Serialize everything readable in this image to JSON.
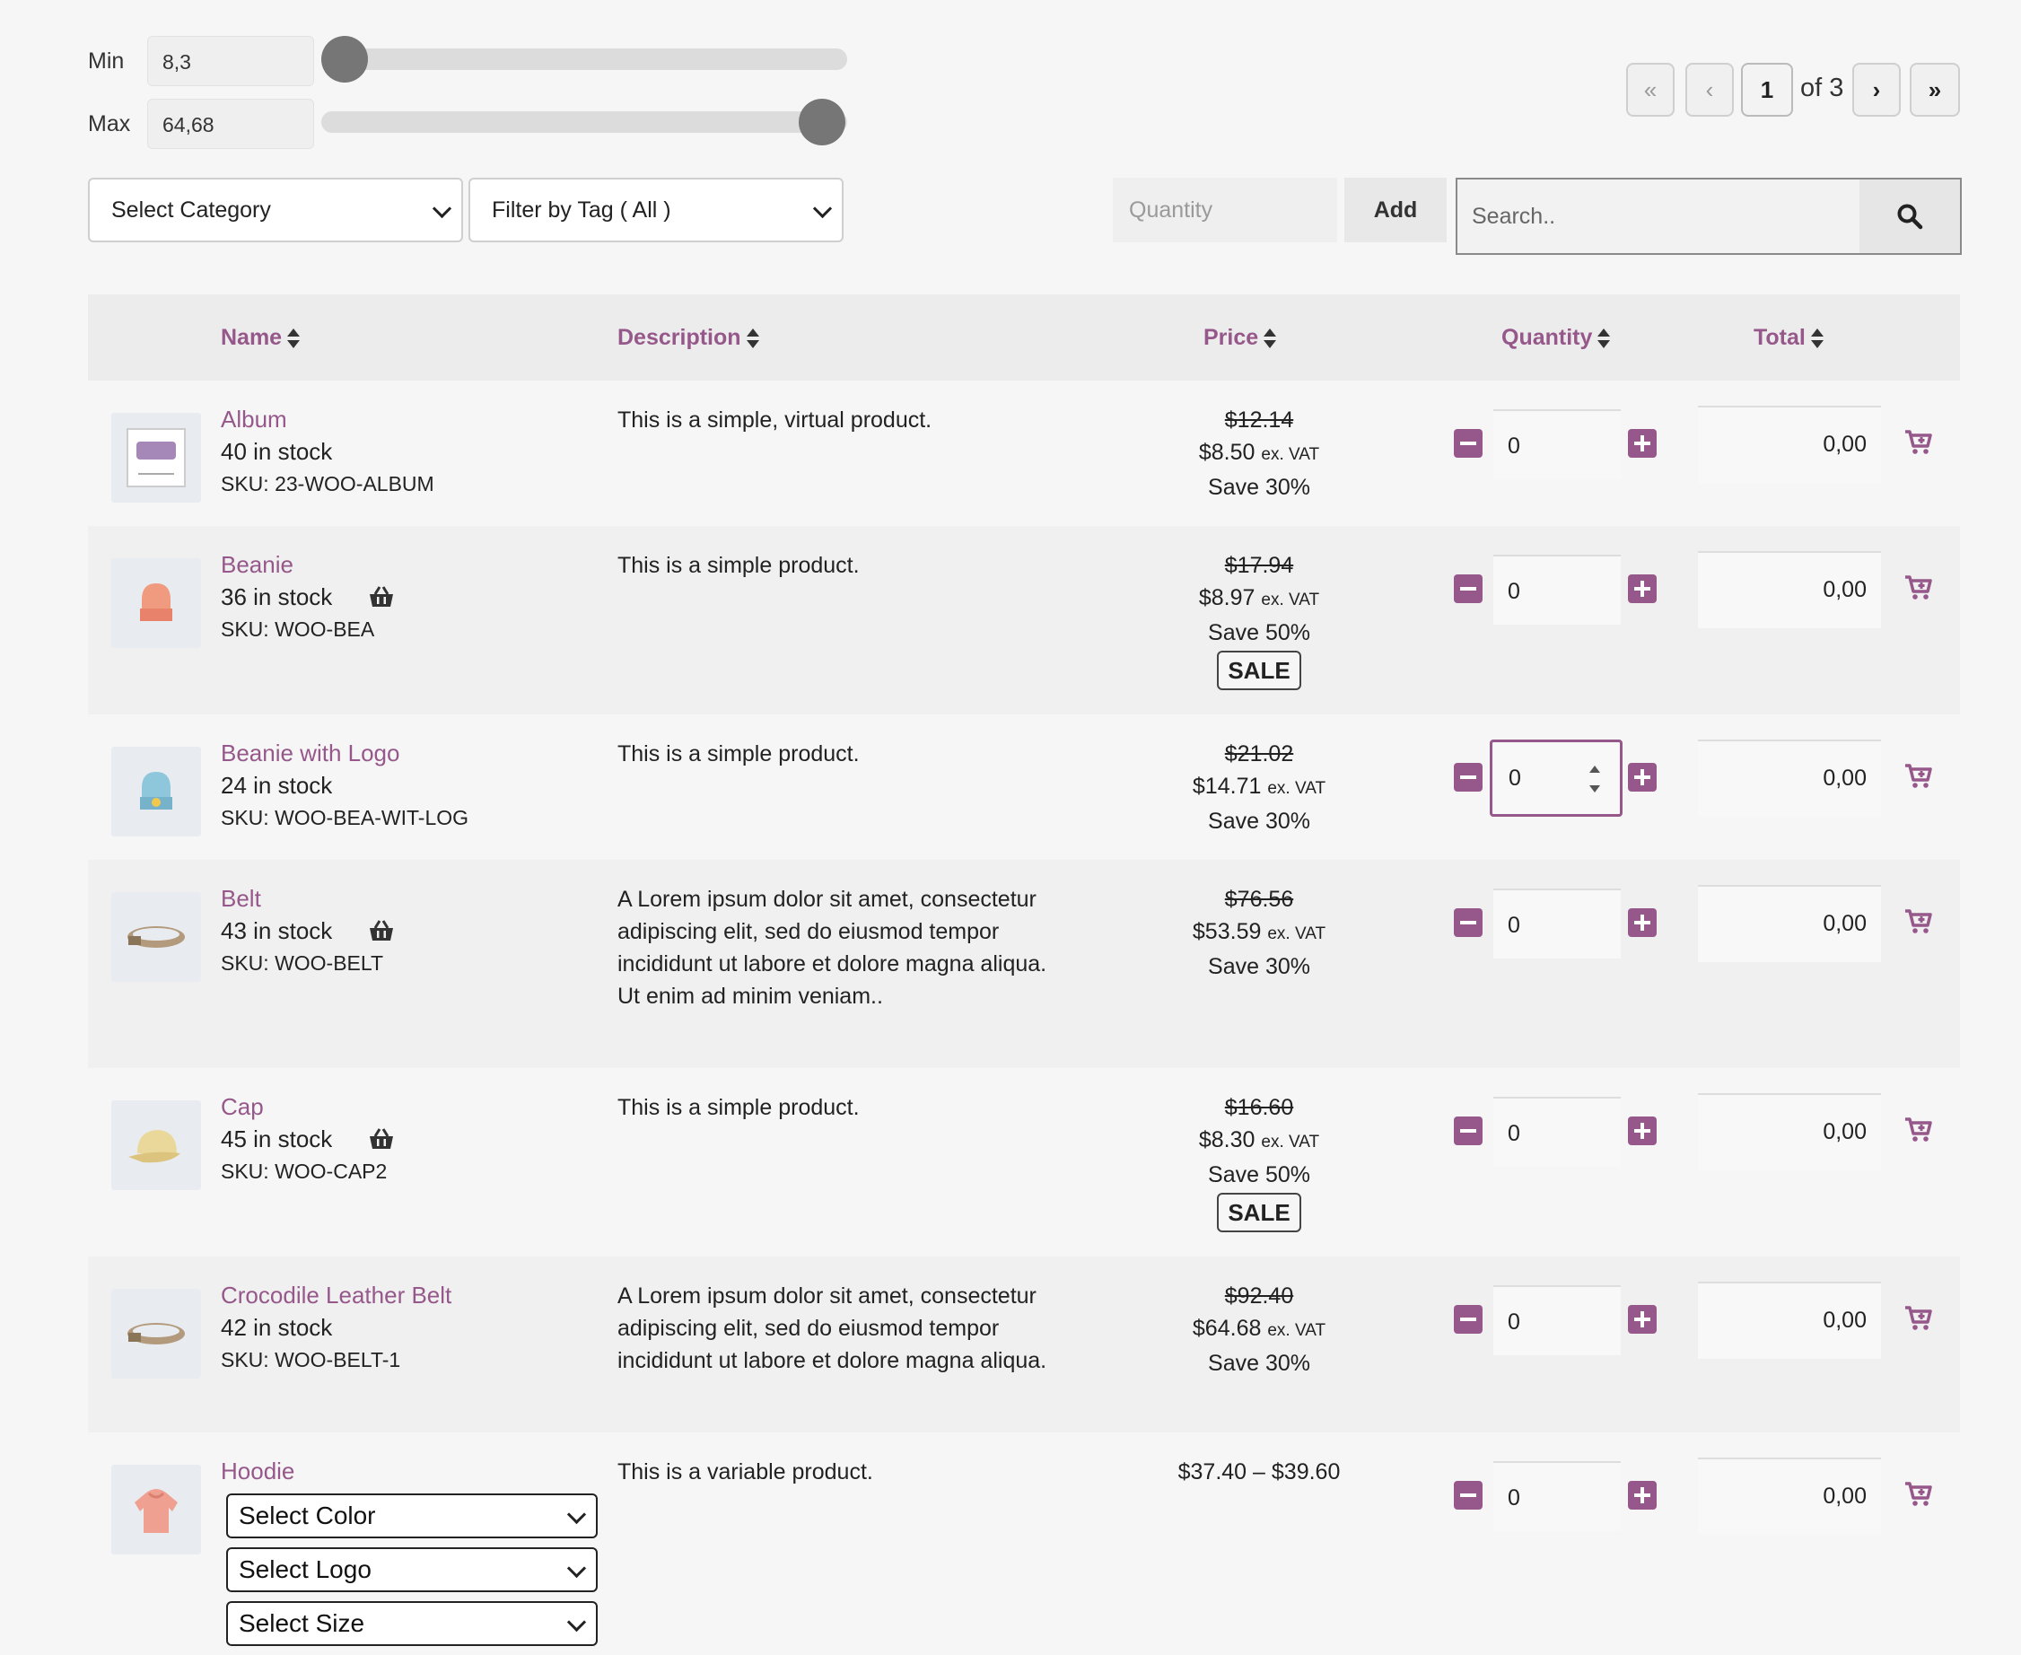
{
  "price_filter": {
    "min_label": "Min",
    "min_value": "8,3",
    "max_label": "Max",
    "max_value": "64,68"
  },
  "pagination": {
    "first": "«",
    "prev": "‹",
    "current": "1",
    "of_total": "of 3",
    "next": "›",
    "last": "»"
  },
  "filters": {
    "category": "Select Category",
    "tag": "Filter by Tag ( All )",
    "quantity_placeholder": "Quantity",
    "add_label": "Add",
    "search_placeholder": "Search.."
  },
  "table": {
    "headers": {
      "name": "Name",
      "description": "Description",
      "price": "Price",
      "quantity": "Quantity",
      "total": "Total"
    },
    "vat_label": "ex. VAT",
    "rows": [
      {
        "name": "Album",
        "stock": "40 in stock",
        "sku": "SKU: 23-WOO-ALBUM",
        "description": "This is a simple, virtual product.",
        "old_price": "$12.14",
        "price": "$8.50",
        "save": "Save 30%",
        "sale": "",
        "qty": "0",
        "total": "0,00",
        "icon": "album-icon"
      },
      {
        "name": "Beanie",
        "stock": "36 in stock",
        "sku": "SKU: WOO-BEA",
        "description": "This is a simple product.",
        "old_price": "$17.94",
        "price": "$8.97",
        "save": "Save 50%",
        "sale": "SALE",
        "qty": "0",
        "total": "0,00",
        "icon": "beanie-icon"
      },
      {
        "name": "Beanie with Logo",
        "stock": "24 in stock",
        "sku": "SKU: WOO-BEA-WIT-LOG",
        "description": "This is a simple product.",
        "old_price": "$21.02",
        "price": "$14.71",
        "save": "Save 30%",
        "sale": "",
        "qty": "0",
        "total": "0,00",
        "icon": "beanie-logo-icon"
      },
      {
        "name": "Belt",
        "stock": "43 in stock",
        "sku": "SKU: WOO-BELT",
        "description": "A Lorem ipsum dolor sit amet, consectetur adipiscing elit, sed do eiusmod tempor incididunt ut labore et dolore magna aliqua. Ut enim ad minim veniam..",
        "old_price": "$76.56",
        "price": "$53.59",
        "save": "Save 30%",
        "sale": "",
        "qty": "0",
        "total": "0,00",
        "icon": "belt-icon"
      },
      {
        "name": "Cap",
        "stock": "45 in stock",
        "sku": "SKU: WOO-CAP2",
        "description": "This is a simple product.",
        "old_price": "$16.60",
        "price": "$8.30",
        "save": "Save 50%",
        "sale": "SALE",
        "qty": "0",
        "total": "0,00",
        "icon": "cap-icon"
      },
      {
        "name": "Crocodile Leather Belt",
        "stock": "42 in stock",
        "sku": "SKU: WOO-BELT-1",
        "description": "A Lorem ipsum dolor sit amet, consectetur adipiscing elit, sed do eiusmod tempor incididunt ut labore et dolore magna aliqua.",
        "old_price": "$92.40",
        "price": "$64.68",
        "save": "Save 30%",
        "sale": "",
        "qty": "0",
        "total": "0,00",
        "icon": "belt-icon"
      },
      {
        "name": "Hoodie",
        "description": "This is a variable product.",
        "price_range": "$37.40 – $39.60",
        "qty": "0",
        "total": "0,00",
        "icon": "hoodie-icon",
        "variations": [
          "Select Color",
          "Select Logo",
          "Select Size"
        ]
      }
    ]
  },
  "colors": {
    "accent": "#96588a",
    "header_bg": "#ececec"
  }
}
